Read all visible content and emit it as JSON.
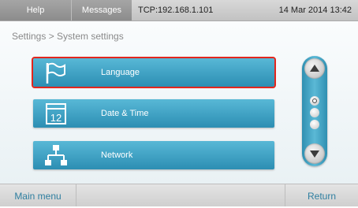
{
  "header": {
    "tabs": [
      {
        "label": "Help"
      },
      {
        "label": "Messages"
      }
    ],
    "connection": "TCP:192.168.1.101",
    "datetime": "14 Mar 2014  13:42"
  },
  "breadcrumb": "Settings > System settings",
  "menu": [
    {
      "label": "Language",
      "icon": "flag-icon",
      "selected": true
    },
    {
      "label": "Date & Time",
      "icon": "calendar-icon",
      "selected": false
    },
    {
      "label": "Network",
      "icon": "network-icon",
      "selected": false
    }
  ],
  "scroller": {
    "page_indicators": 3,
    "active_page": 1
  },
  "footer": {
    "main_menu_label": "Main menu",
    "return_label": "Return"
  },
  "colors": {
    "button": "#3aa0c4",
    "selection_outline": "#e2261d",
    "footer_text": "#2f7fa0"
  }
}
